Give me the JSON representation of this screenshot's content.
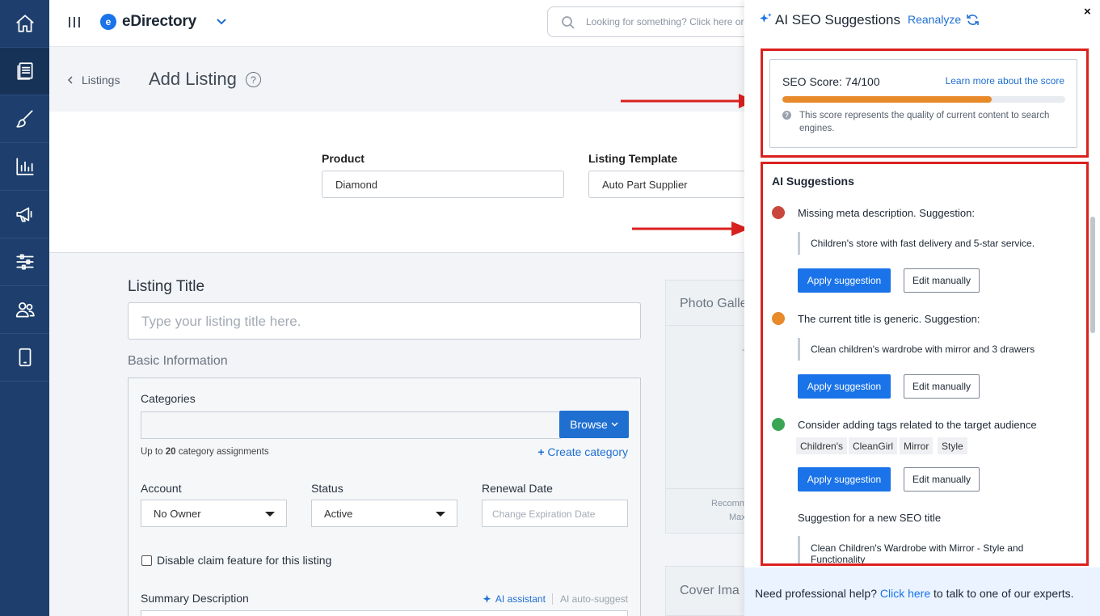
{
  "app": {
    "brand": "eDirectory",
    "search_placeholder": "Looking for something? Click here or"
  },
  "sidebar": {
    "items": [
      {
        "icon": "home-icon"
      },
      {
        "icon": "listings-icon",
        "active": true
      },
      {
        "icon": "brush-icon"
      },
      {
        "icon": "reports-icon"
      },
      {
        "icon": "megaphone-icon"
      },
      {
        "icon": "settings-sliders-icon"
      },
      {
        "icon": "users-icon"
      },
      {
        "icon": "mobile-icon"
      }
    ]
  },
  "header": {
    "breadcrumb": "Listings",
    "page_title": "Add Listing",
    "help": "?"
  },
  "product_section": {
    "product_label": "Product",
    "product_value": "Diamond",
    "template_label": "Listing Template",
    "template_value": "Auto Part Supplier"
  },
  "form": {
    "listing_title_label": "Listing Title",
    "listing_title_placeholder": "Type your listing title here.",
    "basic_info_label": "Basic Information",
    "categories_label": "Categories",
    "browse_label": "Browse",
    "hint_prefix": "Up to",
    "hint_count": "20",
    "hint_suffix": "category assignments",
    "create_category": "Create category",
    "account_label": "Account",
    "account_value": "No Owner",
    "status_label": "Status",
    "status_value": "Active",
    "renewal_label": "Renewal Date",
    "renewal_placeholder": "Change Expiration Date",
    "claim_label": "Disable claim feature for this listing",
    "summary_label": "Summary Description",
    "ai_assistant": "AI assistant",
    "ai_auto_suggest": "AI auto-suggest"
  },
  "side_cards": {
    "photo_title": "Photo Galle",
    "photo_small_1": "-",
    "photo_recommended": "Recomm",
    "photo_max": "Max",
    "cover_title": "Cover Ima"
  },
  "drawer": {
    "title": "AI SEO Suggestions",
    "reanalyze": "Reanalyze",
    "close": "×",
    "score_label": "SEO Score: 74/100",
    "score_value": 74,
    "score_max": 100,
    "score_link": "Learn more about the score",
    "score_desc": "This score represents the quality of current content to search engines.",
    "suggestions_title": "AI Suggestions",
    "suggestions": [
      {
        "color": "#c9463d",
        "text": "Missing meta description. Suggestion:",
        "quote": "Children's store with fast delivery and 5-star service."
      },
      {
        "color": "#e8892a",
        "text": "The current title is generic. Suggestion:",
        "quote": "Clean children's wardrobe with mirror and 3 drawers"
      },
      {
        "color": "#3aa655",
        "text": "Consider adding tags related to the target audience",
        "tags": [
          "Children's",
          "CleanGirl",
          "Mirror",
          "Style"
        ]
      },
      {
        "text": "Suggestion for a new SEO title",
        "quote": "Clean Children's Wardrobe with Mirror - Style and Functionality"
      }
    ],
    "apply_label": "Apply suggestion",
    "edit_label": "Edit manually",
    "footer_prefix": "Need professional help?",
    "footer_link": "Click here",
    "footer_suffix": "to talk to one of our experts."
  },
  "colors": {
    "rail": "#1e3f6d",
    "accent": "#1a73e8",
    "highlight_frame": "#d9211f",
    "score_fill": "#e8892a"
  }
}
